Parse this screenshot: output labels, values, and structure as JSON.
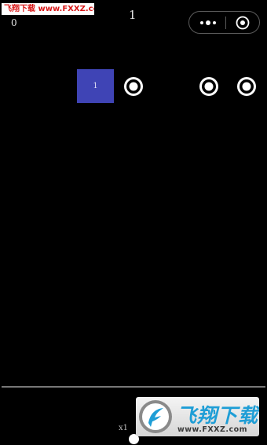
{
  "watermark": {
    "top_text": "飞翔下载 www.FXXZ.com",
    "logo_cn": "飞翔下载",
    "logo_url": "www.FXXZ.com"
  },
  "hud": {
    "zero_count": "0",
    "top_number": "1",
    "multiplier": "x1"
  },
  "block": {
    "label": "1",
    "color": "#3f44b5"
  },
  "mini_program_capsule": {
    "more_icon": "more-dots-icon",
    "close_icon": "target-close-icon"
  },
  "targets": [
    "ring-icon",
    "ring-icon",
    "ring-icon"
  ],
  "colors": {
    "background": "#000000",
    "ring": "#ffffff",
    "ground_line": "#777777",
    "watermark_red": "#d81818",
    "logo_blue": "#1f9ed6"
  }
}
